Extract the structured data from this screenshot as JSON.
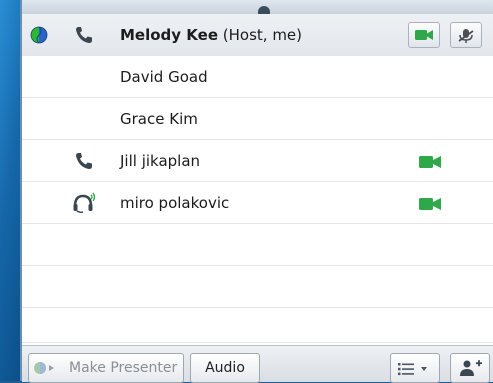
{
  "participants": [
    {
      "name": "Melody Kee",
      "role": "(Host, me)",
      "is_host": true,
      "has_status": true,
      "audio": "phone",
      "video": true
    },
    {
      "name": "David Goad",
      "audio": "none",
      "video": false
    },
    {
      "name": "Grace Kim",
      "audio": "none",
      "video": false
    },
    {
      "name": "Jill jikaplan",
      "audio": "phone",
      "video": true
    },
    {
      "name": "miro polakovic",
      "audio": "headset",
      "video": true
    }
  ],
  "toolbar": {
    "make_presenter_label": "Make Presenter",
    "audio_label": "Audio"
  },
  "icons": {
    "status": "globe-status-icon",
    "phone": "phone-icon",
    "headset": "headset-speaking-icon",
    "video": "video-camera-icon",
    "mute": "mute-microphone-icon",
    "list": "list-view-icon",
    "add_user": "add-participant-icon"
  },
  "colors": {
    "video_green": "#2fa84a",
    "phone_dark": "#3a4650",
    "status_green": "#2dba2d",
    "status_blue": "#2a62c9"
  }
}
